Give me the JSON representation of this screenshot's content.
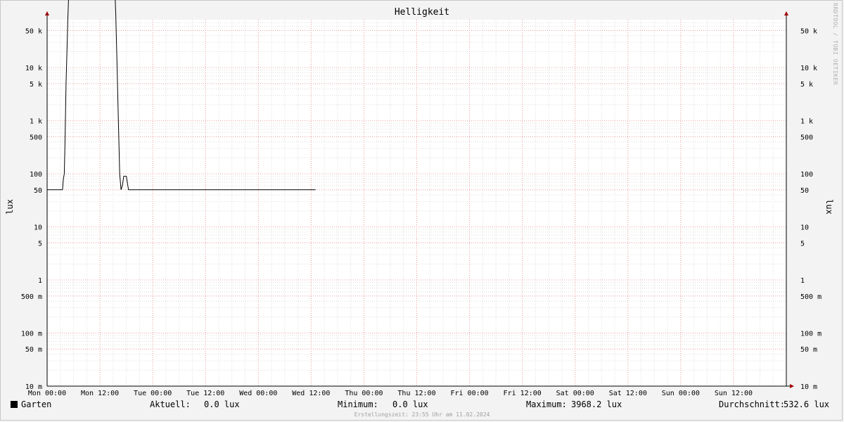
{
  "chart_data": {
    "type": "line",
    "title": "Helligkeit",
    "ylabel": "lux",
    "yscale": "log",
    "ylim": [
      10,
      80000
    ],
    "xlim": [
      0,
      168
    ],
    "y_ticks": [
      {
        "value": 10,
        "label": "10 m"
      },
      {
        "value": 50,
        "label": "50 m"
      },
      {
        "value": 100,
        "label": "100 m"
      },
      {
        "value": 500,
        "label": "500 m"
      },
      {
        "value": 1000,
        "label": "1"
      },
      {
        "value": 5000,
        "label": "5"
      },
      {
        "value": 10000,
        "label": "10"
      },
      {
        "value": 50000,
        "label": "50"
      },
      {
        "value": 100000,
        "label": "100"
      },
      {
        "value": 500000,
        "label": "500"
      },
      {
        "value": 1000000,
        "label": "1 k"
      },
      {
        "value": 5000000,
        "label": "5 k"
      },
      {
        "value": 10000000,
        "label": "10 k"
      },
      {
        "value": 50000000,
        "label": "50 k"
      }
    ],
    "x_ticks": [
      {
        "value": 0,
        "label": "Mon 00:00"
      },
      {
        "value": 12,
        "label": "Mon 12:00"
      },
      {
        "value": 24,
        "label": "Tue 00:00"
      },
      {
        "value": 36,
        "label": "Tue 12:00"
      },
      {
        "value": 48,
        "label": "Wed 00:00"
      },
      {
        "value": 60,
        "label": "Wed 12:00"
      },
      {
        "value": 72,
        "label": "Thu 00:00"
      },
      {
        "value": 84,
        "label": "Thu 12:00"
      },
      {
        "value": 96,
        "label": "Fri 00:00"
      },
      {
        "value": 108,
        "label": "Fri 12:00"
      },
      {
        "value": 120,
        "label": "Sat 00:00"
      },
      {
        "value": 132,
        "label": "Sat 12:00"
      },
      {
        "value": 144,
        "label": "Sun 00:00"
      },
      {
        "value": 156,
        "label": "Sun 12:00"
      }
    ],
    "series": [
      {
        "name": "Garten",
        "color": "#000000",
        "x": [
          0,
          3.5,
          3.7,
          3.9,
          4.1,
          4.3,
          4.5,
          4.7,
          5.0,
          5.4,
          5.8,
          6.3,
          6.8,
          7.2,
          7.6,
          8.0,
          8.5,
          9.0,
          9.4,
          9.8,
          10.2,
          10.6,
          10.9,
          11.2,
          11.6,
          12.0,
          12.5,
          13.0,
          13.5,
          14.0,
          14.5,
          15.0,
          15.3,
          15.6,
          15.9,
          16.2,
          16.5,
          16.8,
          17.1,
          17.4,
          17.7,
          18.0,
          18.5,
          19.0,
          19.6,
          19.8,
          20.5,
          20.8,
          21.0,
          60,
          61
        ],
        "y": [
          50000,
          50000,
          80000,
          100000,
          500000,
          5000000,
          20000000,
          80000000,
          400000000,
          1000000000.0,
          1300000000.0,
          1600000000.0,
          1900000000.0,
          2200000000.0,
          2400000000.0,
          2600000000.0,
          2400000000.0,
          2800000000.0,
          3000000000.0,
          2900000000.0,
          3100000000.0,
          2800000000.0,
          2400000000.0,
          2600000000.0,
          2500000000.0,
          2700000000.0,
          2500000000.0,
          2300000000.0,
          2000000000.0,
          1600000000.0,
          1200000000.0,
          800000000,
          500000000,
          100000000,
          10000000,
          1000000,
          100000,
          50000,
          60000,
          90000,
          90000,
          90000,
          50000,
          50000,
          50000,
          50000,
          50000,
          50000,
          50000,
          50000,
          50000
        ]
      }
    ],
    "grid": true,
    "legend": "bottom-left"
  },
  "legend": {
    "series_name": "Garten",
    "current_label": "Aktuell:",
    "current_value": "0.0 lux",
    "min_label": "Minimum:",
    "min_value": "0.0 lux",
    "max_label": "Maximum:",
    "max_value": "3968.2 lux",
    "avg_label": "Durchschnitt:",
    "avg_value": "532.6 lux"
  },
  "footer": {
    "created": "Erstellungszeit: 23:55 Uhr am 11.02.2024"
  },
  "watermark": "RRDTOOL / TOBI OETIKER",
  "colors": {
    "background": "#f3f3f3",
    "plot_bg": "#ffffff",
    "line": "#000000",
    "grid_minor": "#dddddd",
    "grid_major": "#f0a0a0",
    "arrow": "#a00000"
  }
}
